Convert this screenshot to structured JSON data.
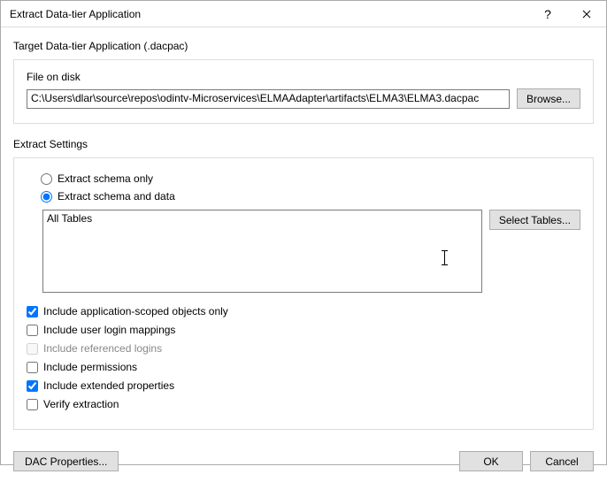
{
  "title": "Extract Data-tier Application",
  "target": {
    "group_label": "Target Data-tier Application (.dacpac)",
    "file_label": "File on disk",
    "path": "C:\\Users\\dlar\\source\\repos\\odintv-Microservices\\ELMAAdapter\\artifacts\\ELMA3\\ELMA3.dacpac",
    "browse_label": "Browse..."
  },
  "settings": {
    "group_label": "Extract Settings",
    "schema_only_label": "Extract schema only",
    "schema_and_data_label": "Extract schema and data",
    "selected_mode": "schema_and_data",
    "tables_text": "All Tables",
    "select_tables_label": "Select Tables..."
  },
  "checks": {
    "app_scoped": {
      "label": "Include application-scoped objects only",
      "checked": true
    },
    "user_login": {
      "label": "Include user login mappings",
      "checked": false
    },
    "ref_logins": {
      "label": "Include referenced logins",
      "checked": false,
      "disabled": true
    },
    "permissions": {
      "label": "Include permissions",
      "checked": false
    },
    "extended": {
      "label": "Include extended properties",
      "checked": true
    },
    "verify": {
      "label": "Verify extraction",
      "checked": false
    }
  },
  "footer": {
    "dac_props": "DAC Properties...",
    "ok": "OK",
    "cancel": "Cancel"
  }
}
